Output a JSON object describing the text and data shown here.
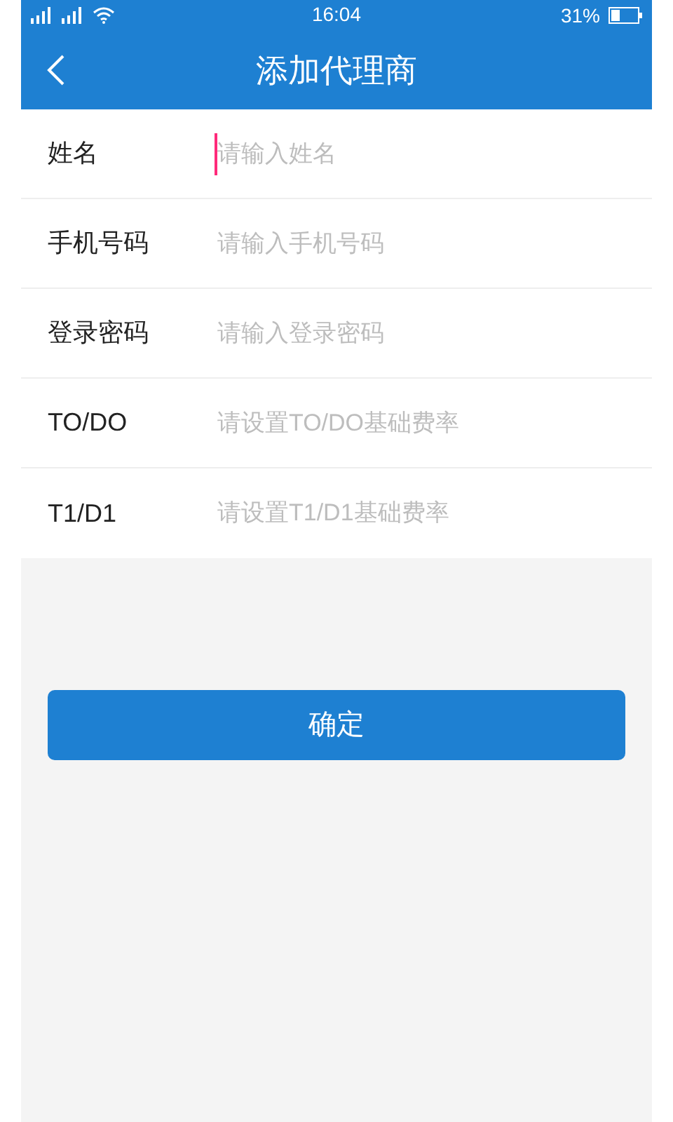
{
  "status_bar": {
    "time": "16:04",
    "battery": "31%"
  },
  "header": {
    "title": "添加代理商"
  },
  "fields": [
    {
      "label": "姓名",
      "placeholder": "请输入姓名",
      "focused": true
    },
    {
      "label": "手机号码",
      "placeholder": "请输入手机号码",
      "focused": false
    },
    {
      "label": "登录密码",
      "placeholder": "请输入登录密码",
      "focused": false
    },
    {
      "label": "TO/DO",
      "placeholder": "请设置TO/DO基础费率",
      "focused": false
    },
    {
      "label": "T1/D1",
      "placeholder": "请设置T1/D1基础费率",
      "focused": false
    }
  ],
  "submit_button": {
    "label": "确定"
  }
}
